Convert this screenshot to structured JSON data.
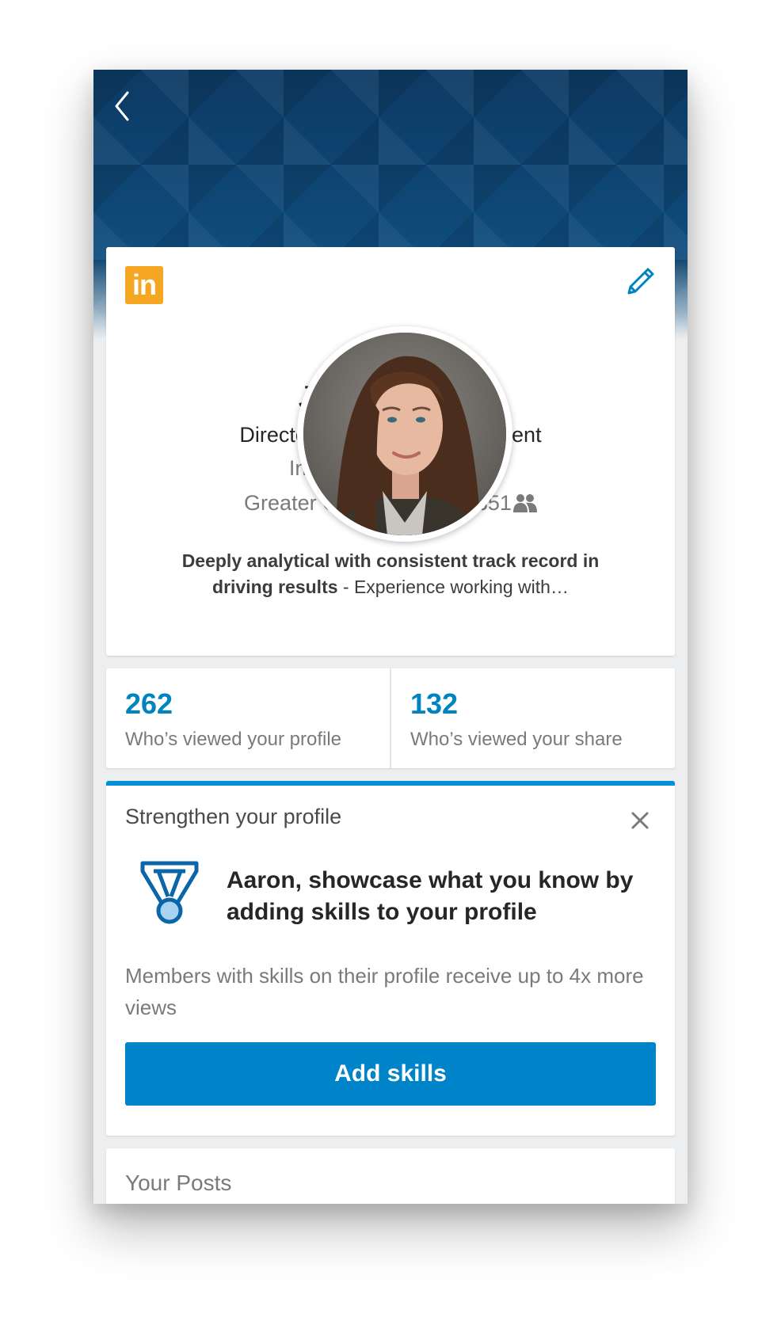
{
  "nav": {
    "back_icon": "chevron-left-icon"
  },
  "profile": {
    "name": "Jenna Miller",
    "headline": "Director of Project Management",
    "school": "Indiana University ‘11",
    "location": "Greater Chicago Area",
    "separator": "•",
    "connections": "351",
    "summary_bold": "Deeply analytical with consistent track record in driving results",
    "summary_rest": " - Experience working with…"
  },
  "stats": [
    {
      "count": "262",
      "label": "Who’s viewed your profile"
    },
    {
      "count": "132",
      "label": "Who’s viewed your share"
    }
  ],
  "strengthen": {
    "title": "Strengthen your profile",
    "cta": "Aaron, showcase what you know by adding skills to your profile",
    "description": "Members with skills on their profile receive up to 4x more views",
    "button_label": "Add skills"
  },
  "posts": {
    "title": "Your Posts"
  },
  "colors": {
    "accent": "#0084bf",
    "button": "#0084c9",
    "brand_logo": "#f5a623",
    "hero": "#0e4a7a"
  }
}
